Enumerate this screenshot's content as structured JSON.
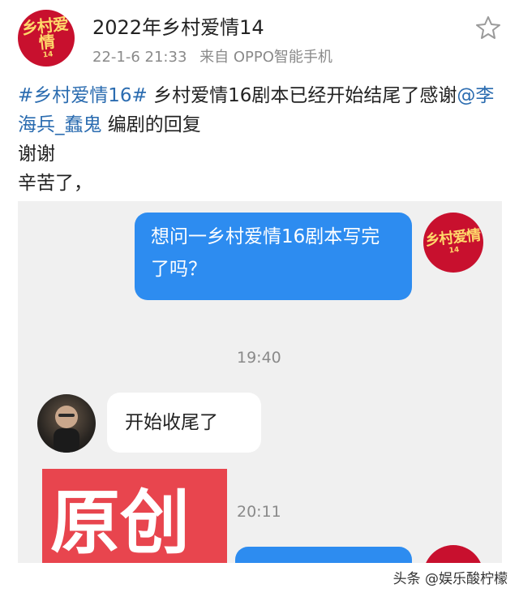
{
  "header": {
    "account_name": "2022年乡村爱情14",
    "date": "22-1-6 21:33",
    "source": "来自 OPPO智能手机",
    "avatar_logo_text": "乡村爱情",
    "avatar_logo_sub": "14"
  },
  "post": {
    "hashtag": "#乡村爱情16#",
    "text_part1": " 乡村爱情16剧本已经开始结尾了感谢",
    "mention": "@李海兵_蠢鬼",
    "text_part2": " 编剧的回复",
    "line2": "谢谢",
    "line3": "辛苦了，"
  },
  "chat": {
    "outgoing_message_1": "想问一乡村爱情16剧本写完了吗？",
    "timestamp_1": "19:40",
    "incoming_message_1": "开始收尾了",
    "image_text": "原创",
    "timestamp_2": "20:11"
  },
  "watermark": "头条 @娱乐酸柠檬",
  "colors": {
    "accent_blue": "#2d8cf0",
    "link_blue": "#2b6cb0",
    "brand_red": "#c8102e"
  },
  "icons": {
    "favorite": "star-outline-icon"
  }
}
